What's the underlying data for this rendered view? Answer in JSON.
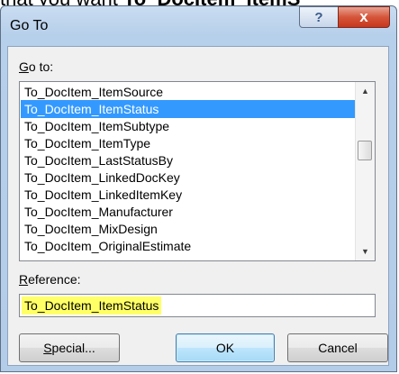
{
  "background_text": {
    "pre": "that you want   ",
    "underlined": "To_DocItem_ItemS"
  },
  "dialog": {
    "title": "Go To",
    "help_label": "?",
    "close_label": "x",
    "goto_label_accel": "G",
    "goto_label_rest": "o to:",
    "reference_label_accel": "R",
    "reference_label_rest": "eference:",
    "reference_value": "To_DocItem_ItemStatus",
    "list_items": [
      "To_DocItem_ItemSource",
      "To_DocItem_ItemStatus",
      "To_DocItem_ItemSubtype",
      "To_DocItem_ItemType",
      "To_DocItem_LastStatusBy",
      "To_DocItem_LinkedDocKey",
      "To_DocItem_LinkedItemKey",
      "To_DocItem_Manufacturer",
      "To_DocItem_MixDesign",
      "To_DocItem_OriginalEstimate"
    ],
    "selected_index": 1,
    "buttons": {
      "special_accel": "S",
      "special_rest": "pecial...",
      "ok": "OK",
      "cancel": "Cancel"
    }
  },
  "colors": {
    "selection": "#3399ff",
    "highlight": "#ffff66",
    "close_button": "#c7371c"
  }
}
